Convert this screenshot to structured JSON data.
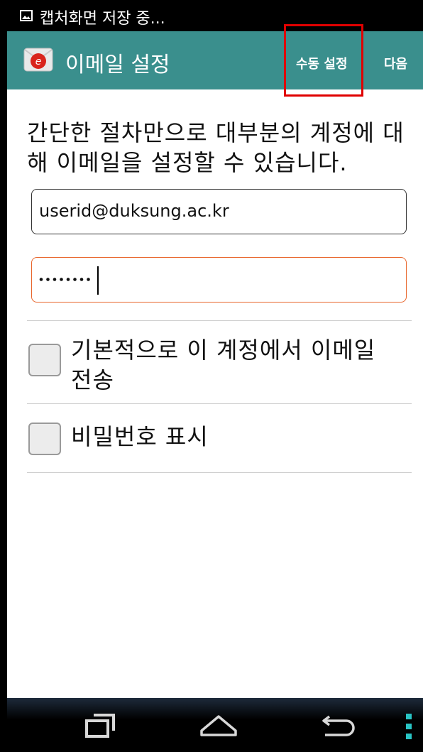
{
  "status_bar": {
    "text": "캡처화면 저장 중..."
  },
  "action_bar": {
    "title": "이메일 설정",
    "manual_setup": "수동 설정",
    "next": "다음"
  },
  "intro_text": "간단한 절차만으로 대부분의 계정에 대해 이메일을 설정할 수 있습니다.",
  "email_field": {
    "value": "userid@duksung.ac.kr"
  },
  "password_field": {
    "masked_length": 8
  },
  "options": {
    "send_default": "기본적으로 이 계정에서 이메일 전송",
    "show_password": "비밀번호 표시"
  },
  "colors": {
    "action_bar": "#3a8f8d",
    "focus_border": "#e8662c",
    "highlight": "#e00000",
    "menu_dots": "#29c4c4"
  },
  "icons": [
    "image-icon",
    "email-app-icon",
    "recent-apps-icon",
    "home-icon",
    "back-icon",
    "menu-dots-icon"
  ]
}
